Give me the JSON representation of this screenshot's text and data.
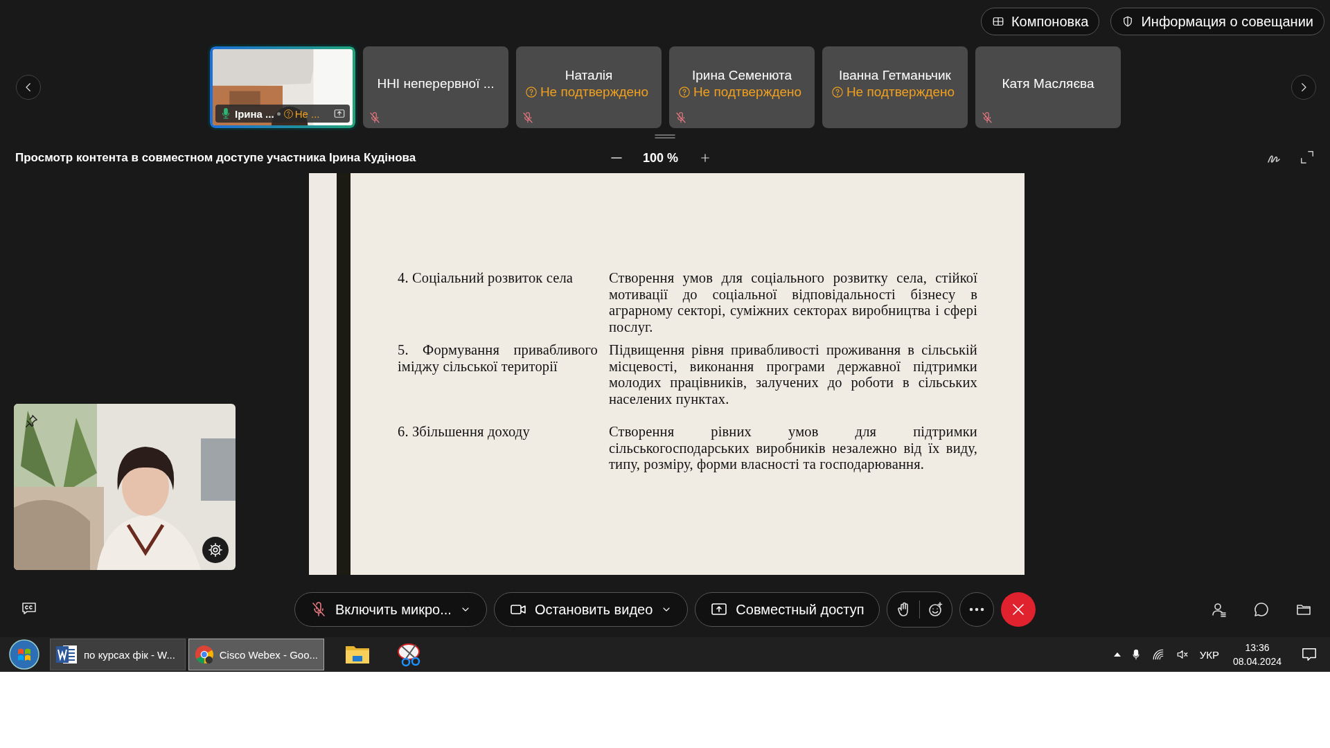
{
  "top_buttons": [
    {
      "kind": "layout",
      "label": "Компоновка"
    },
    {
      "kind": "info",
      "label": "Информация о совещании"
    }
  ],
  "participants": [
    {
      "kind": "video",
      "name": "Ірина ...",
      "status": "Не ...",
      "selected": true,
      "muted": false
    },
    {
      "kind": "name",
      "name": "ННІ неперервної ...",
      "selected": false,
      "muted": true
    },
    {
      "kind": "name",
      "name": "Наталія",
      "status": "Не подтверждено",
      "selected": false,
      "muted": true
    },
    {
      "kind": "name",
      "name": "Ірина Семенюта",
      "status": "Не подтверждено",
      "selected": false,
      "muted": true
    },
    {
      "kind": "name",
      "name": "Іванна Гетманьчик",
      "status": "Не подтверждено",
      "selected": false
    },
    {
      "kind": "name",
      "name": "Катя Масляєва",
      "selected": false,
      "muted": true
    }
  ],
  "share": {
    "title": "Просмотр контента в совместном доступе участника Ірина Кудінова",
    "zoom": "100 %"
  },
  "document": {
    "rows": [
      {
        "topic": "4. Соціальний розвиток села",
        "description": "Створення умов для соціального розвитку села, стійкої мотивації до соціальної відповідальності бізнесу в аграрному секторі, суміжних секторах виробництва і сфері послуг."
      },
      {
        "topic": "5. Формування привабливого іміджу сільської території",
        "description": "Підвищення рівня привабливості проживання в сільській місцевості, виконання програми державної підтримки молодих працівників, залучених до роботи в сільських населених пунктах."
      },
      {
        "topic": "6. Збільшення доходу",
        "description": "Створення рівних умов для підтримки сільськогосподарських виробників незалежно від їх виду, типу, розміру, форми власності та господарювання."
      }
    ]
  },
  "toolbar": [
    {
      "kind": "mic",
      "label": "Включить микро..."
    },
    {
      "kind": "video",
      "label": "Остановить видео"
    },
    {
      "kind": "share",
      "label": "Совместный доступ"
    }
  ],
  "taskbar": {
    "tasks": [
      {
        "kind": "word",
        "label": "по курсах фік - W...",
        "selected": false
      },
      {
        "kind": "chrome",
        "label": "Cisco Webex - Goo...",
        "selected": true
      }
    ],
    "language": "УКР",
    "time": "13:36",
    "date": "08.04.2024"
  }
}
